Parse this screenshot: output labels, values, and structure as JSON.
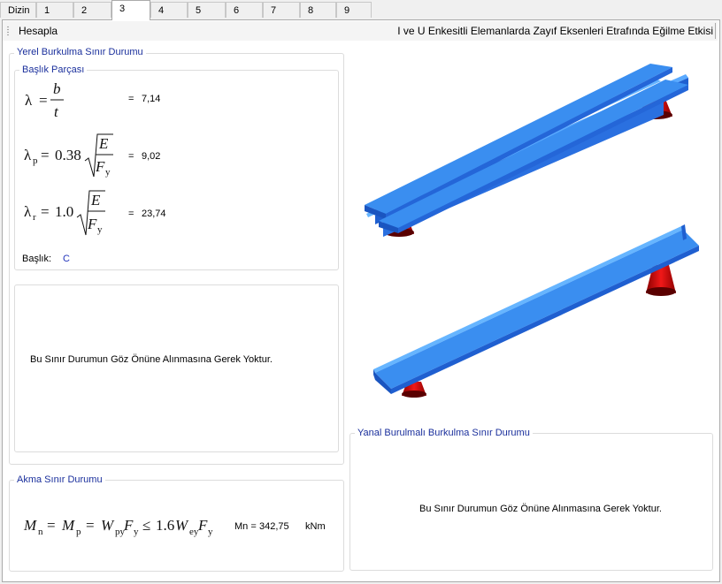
{
  "tabs": [
    "Dizin",
    "1",
    "2",
    "3",
    "4",
    "5",
    "6",
    "7",
    "8",
    "9"
  ],
  "active_tab": "3",
  "toolbar": {
    "calculate_label": "Hesapla",
    "title": "I ve U Enkesitli Elemanlarda Zayıf Eksenleri Etrafında Eğilme Etkisi"
  },
  "local_buckling": {
    "legend": "Yerel Burkulma Sınır Durumu",
    "flange": {
      "legend": "Başlık Parçası",
      "lambda_value": "7,14",
      "lambda_p_value": "9,02",
      "lambda_r_value": "23,74",
      "class_label": "Başlık:",
      "class_value": "C",
      "eq": "="
    },
    "message": "Bu Sınır Durumun Göz Önüne Alınmasına Gerek Yoktur."
  },
  "yield": {
    "legend": "Akma Sınır Durumu",
    "result_label": "Mn =",
    "result_value": "342,75",
    "unit": "kNm"
  },
  "ltb": {
    "legend": "Yanal Burulmalı Burkulma Sınır Durumu",
    "message": "Bu Sınır Durumun Göz Önüne Alınmasına Gerek Yoktur."
  },
  "colors": {
    "beam_top": "#3a8ef0",
    "beam_side": "#1f5fd0",
    "support": "#d81010",
    "legend_text": "#1a2f9c",
    "value_blue": "#2233bb"
  }
}
